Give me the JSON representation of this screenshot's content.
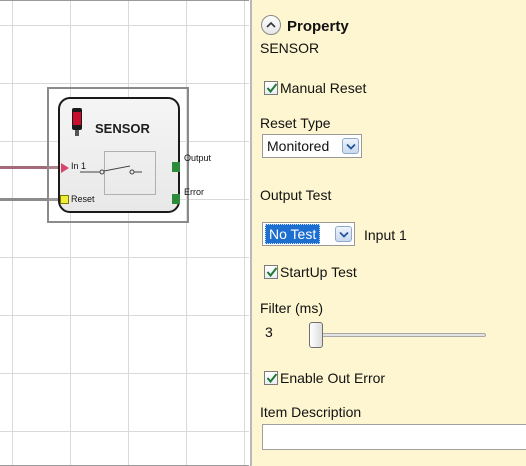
{
  "block": {
    "title": "SENSOR",
    "inputs": [
      "In 1",
      "Reset"
    ],
    "outputs": [
      "Output",
      "Error"
    ]
  },
  "panel": {
    "header": "Property",
    "type_label": "SENSOR",
    "manual_reset": {
      "label": "Manual Reset",
      "checked": true
    },
    "reset_type": {
      "label": "Reset Type",
      "value": "Monitored"
    },
    "output_test": {
      "label": "Output Test",
      "value": "No Test",
      "input_label": "Input 1"
    },
    "startup_test": {
      "label": "StartUp Test",
      "checked": true
    },
    "filter": {
      "label": "Filter (ms)",
      "value": "3"
    },
    "enable_out_error": {
      "label": "Enable Out Error",
      "checked": true
    },
    "item_description": {
      "label": "Item Description",
      "value": ""
    }
  },
  "icons": [
    "sensor-icon",
    "collapse-up-icon",
    "checkmark-icon",
    "dropdown-arrow-icon",
    "switch-symbol-icon"
  ],
  "colors": {
    "panel_bg": "#fdf6d0",
    "input_pin": "#d9446a",
    "reset_pin": "#f1ec3a",
    "output_pin": "#2e8b3a",
    "selection": "#1c6fd0",
    "checkmark": "#1f7a36"
  }
}
